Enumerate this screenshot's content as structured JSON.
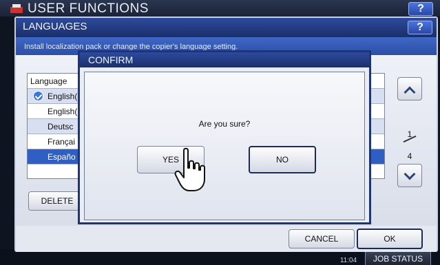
{
  "background": {
    "title": "USER FUNCTIONS",
    "help_label": "?"
  },
  "languages_window": {
    "title": "LANGUAGES",
    "help_label": "?",
    "message": "Install localization pack or change the copier's language setting.",
    "table": {
      "header": "Language",
      "rows": [
        {
          "label": "English(",
          "checked": true,
          "selected": false
        },
        {
          "label": "English(",
          "checked": false,
          "selected": false
        },
        {
          "label": "Deutsc",
          "checked": false,
          "selected": false
        },
        {
          "label": "Françai",
          "checked": false,
          "selected": false
        },
        {
          "label": "Españo",
          "checked": false,
          "selected": true
        }
      ]
    },
    "page_current": "1",
    "page_total": "4",
    "delete_label": "DELETE",
    "cancel_label": "CANCEL",
    "ok_label": "OK"
  },
  "confirm_dialog": {
    "title": "CONFIRM",
    "message": "Are you sure?",
    "yes_label": "YES",
    "no_label": "NO"
  },
  "status_bar": {
    "time": "11:04",
    "job_status_label": "JOB STATUS"
  },
  "colors": {
    "title_bar": "#1b2f6b",
    "selected_row": "#2f5fc4",
    "check_icon": "#3b79d9"
  },
  "icons": [
    "user-functions-logo-icon",
    "help-icon",
    "check-icon",
    "chevron-up-icon",
    "chevron-down-icon",
    "hand-pointer-icon"
  ]
}
